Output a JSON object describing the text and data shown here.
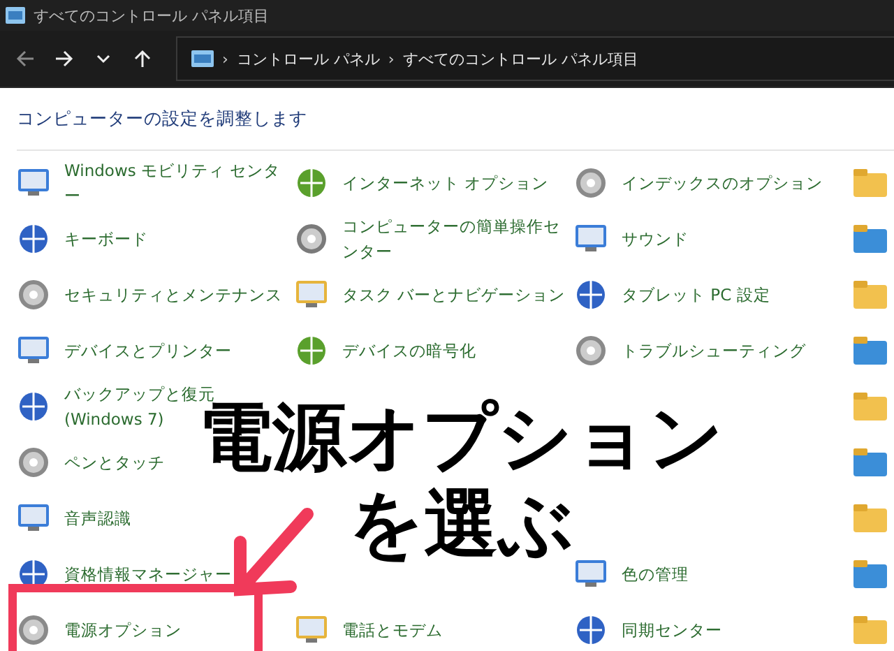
{
  "window": {
    "title": "すべてのコントロール パネル項目"
  },
  "address_bar": {
    "separator": "›",
    "path": [
      "コントロール パネル",
      "すべてのコントロール パネル項目"
    ]
  },
  "heading": "コンピューターの設定を調整します",
  "items": [
    {
      "kind": "item",
      "label": "Windows モビリティ センター"
    },
    {
      "kind": "item",
      "label": "インターネット オプション"
    },
    {
      "kind": "item",
      "label": "インデックスのオプション"
    },
    {
      "kind": "covered"
    },
    {
      "kind": "item",
      "label": "キーボード"
    },
    {
      "kind": "item",
      "label": "コンピューターの簡単操作センター"
    },
    {
      "kind": "item",
      "label": "サウンド"
    },
    {
      "kind": "covered"
    },
    {
      "kind": "item",
      "label": "セキュリティとメンテナンス"
    },
    {
      "kind": "item",
      "label": "タスク バーとナビゲーション"
    },
    {
      "kind": "item",
      "label": "タブレット PC 設定"
    },
    {
      "kind": "covered"
    },
    {
      "kind": "item",
      "label": "デバイスとプリンター"
    },
    {
      "kind": "item",
      "label": "デバイスの暗号化"
    },
    {
      "kind": "item",
      "label": "トラブルシューティング"
    },
    {
      "kind": "covered"
    },
    {
      "kind": "item",
      "label": "バックアップと復元 (Windows 7)"
    },
    {
      "kind": "covered"
    },
    {
      "kind": "covered"
    },
    {
      "kind": "covered"
    },
    {
      "kind": "item",
      "label": "ペンとタッチ"
    },
    {
      "kind": "covered"
    },
    {
      "kind": "covered"
    },
    {
      "kind": "covered"
    },
    {
      "kind": "item",
      "label": "音声認識"
    },
    {
      "kind": "covered"
    },
    {
      "kind": "covered"
    },
    {
      "kind": "covered"
    },
    {
      "kind": "item",
      "label": "資格情報マネージャー"
    },
    {
      "kind": "covered"
    },
    {
      "kind": "item",
      "label": "色の管理"
    },
    {
      "kind": "covered"
    },
    {
      "kind": "item",
      "label": "電源オプション"
    },
    {
      "kind": "item",
      "label": "電話とモデム"
    },
    {
      "kind": "item",
      "label": "同期センター"
    },
    {
      "kind": "covered"
    }
  ],
  "annotation": {
    "lines": [
      "電源オプション",
      "を選ぶ"
    ]
  }
}
